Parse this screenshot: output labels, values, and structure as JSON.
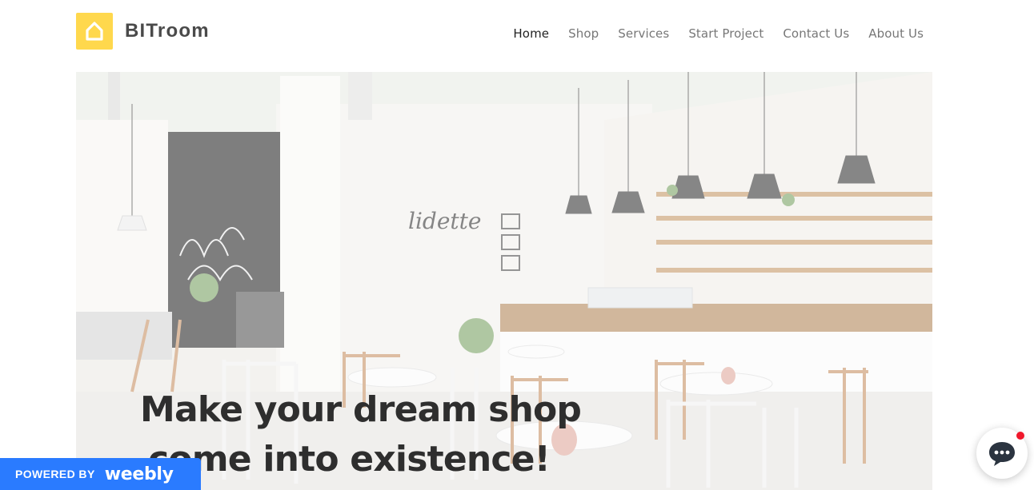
{
  "brand": {
    "name": "BITroom",
    "logo_icon": "house-icon",
    "logo_color": "#ffd84d"
  },
  "nav": {
    "items": [
      {
        "label": "Home",
        "active": true
      },
      {
        "label": "Shop",
        "active": false
      },
      {
        "label": "Services",
        "active": false
      },
      {
        "label": "Start Project",
        "active": false
      },
      {
        "label": "Contact Us",
        "active": false
      },
      {
        "label": "About Us",
        "active": false
      }
    ]
  },
  "hero": {
    "headline_line1": "Make your dream shop",
    "headline_line2": "come into existence!",
    "image_sign_text": "lidette"
  },
  "footer_badge": {
    "powered_by": "POWERED BY",
    "brand": "weebly",
    "color": "#2a7bff"
  },
  "chat_widget": {
    "icon": "chat-bubble-icon",
    "notification_color": "#f0182c"
  }
}
